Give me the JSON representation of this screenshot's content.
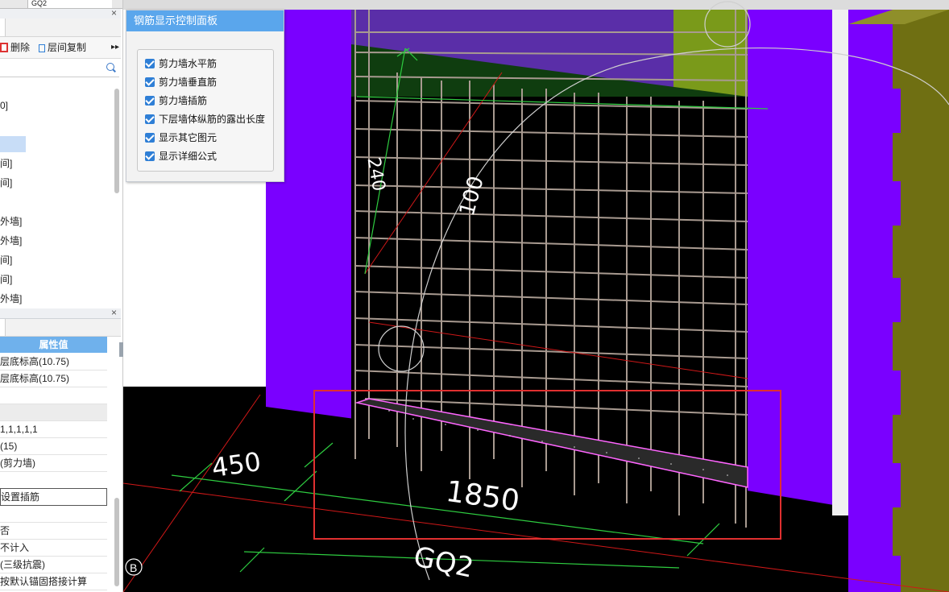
{
  "left_panel": {
    "top_cell_text": "GQ2",
    "toolbar": {
      "delete_label": "删除",
      "copy_label": "层间复制",
      "more_label": "▸▸"
    },
    "search_placeholder": "",
    "tree_items": [
      "0]",
      "间]",
      "间]",
      "外墙]",
      "外墙]",
      "间]",
      "间]",
      "外墙]"
    ]
  },
  "properties": {
    "header": "属性值",
    "rows": [
      "层底标高(10.75)",
      "层底标高(10.75)",
      "",
      "",
      "1,1,1,1,1",
      "(15)",
      "(剪力墙)",
      "",
      "设置插筋",
      "",
      "否",
      "不计入",
      "(三级抗震)",
      "按默认锚固搭接计算"
    ]
  },
  "control_panel": {
    "title": "钢筋显示控制面板",
    "options": [
      "剪力墙水平筋",
      "剪力墙垂直筋",
      "剪力墙插筋",
      "下层墙体纵筋的露出长度",
      "显示其它图元",
      "显示详细公式"
    ],
    "checked": [
      true,
      true,
      true,
      true,
      true,
      true
    ]
  },
  "viewport": {
    "dim_450": "450",
    "dim_1850": "1850",
    "dim_100": "100",
    "dim_240": "240",
    "label_gq2": "GQ2",
    "axis_b": "B",
    "colors": {
      "wall": "#7a00ff",
      "green_band": "#0f3d0f",
      "olive": "#7a9a1a",
      "highlight": "#e03030"
    }
  }
}
